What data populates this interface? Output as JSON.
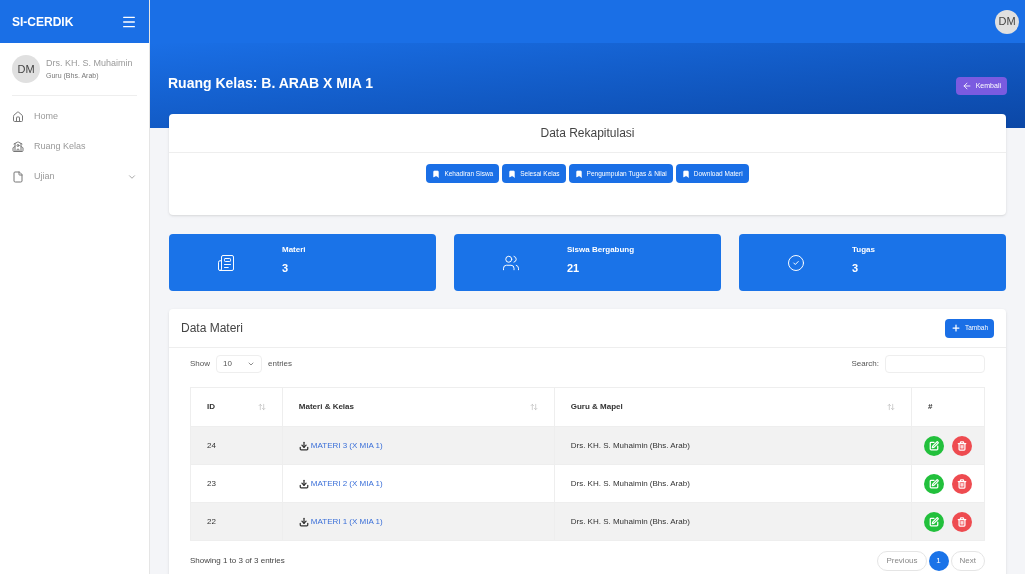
{
  "brand": "SI-CERDIK",
  "top_avatar": "DM",
  "user": {
    "initials": "DM",
    "name": "Drs. KH. S. Muhaimin",
    "role": "Guru (Bhs. Arab)"
  },
  "sidebar": {
    "items": [
      {
        "label": "Home",
        "has_caret": false
      },
      {
        "label": "Ruang Kelas",
        "has_caret": false
      },
      {
        "label": "Ujian",
        "has_caret": true
      }
    ]
  },
  "page_title": "Ruang Kelas: B. ARAB X MIA 1",
  "back_button": "Kembali",
  "recap": {
    "title": "Data Rekapitulasi",
    "buttons": [
      "Kehadiran Siswa",
      "Selesai Kelas",
      "Pengumpulan Tugas & Nilai",
      "Download Materi"
    ]
  },
  "stats": [
    {
      "label": "Materi",
      "value": "3"
    },
    {
      "label": "Siswa Bergabung",
      "value": "21"
    },
    {
      "label": "Tugas",
      "value": "3"
    }
  ],
  "materi": {
    "title": "Data Materi",
    "add_button": "Tambah",
    "show_label": "Show",
    "page_size": "10",
    "entries_label": "entries",
    "search_label": "Search:",
    "columns": [
      {
        "label": "ID",
        "sortable": true
      },
      {
        "label": "Materi & Kelas",
        "sortable": true
      },
      {
        "label": "Guru & Mapel",
        "sortable": true
      },
      {
        "label": "#",
        "sortable": false
      }
    ],
    "rows": [
      {
        "id": "24",
        "materi": "MATERI 3 (X MIA 1)",
        "guru": "Drs. KH. S. Muhaimin (Bhs. Arab)"
      },
      {
        "id": "23",
        "materi": "MATERI 2 (X MIA 1)",
        "guru": "Drs. KH. S. Muhaimin (Bhs. Arab)"
      },
      {
        "id": "22",
        "materi": "MATERI 1 (X MIA 1)",
        "guru": "Drs. KH. S. Muhaimin (Bhs. Arab)"
      }
    ],
    "info": "Showing 1 to 3 of 3 entries",
    "pagination": [
      {
        "label": "Previous",
        "kind": "nav",
        "selected": false
      },
      {
        "label": "1",
        "kind": "page",
        "selected": true
      },
      {
        "label": "Next",
        "kind": "nav",
        "selected": false
      }
    ]
  }
}
